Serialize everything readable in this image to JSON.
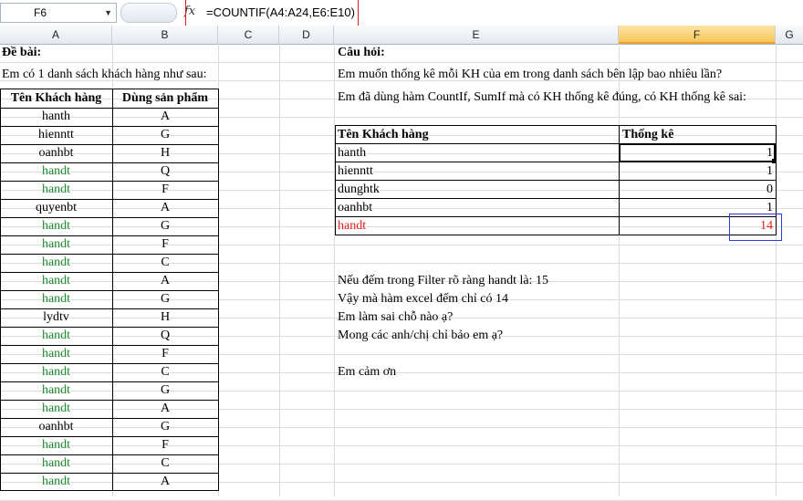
{
  "formula_bar": {
    "name_box": "F6",
    "fx_label": "fx",
    "formula": "=COUNTIF(A4:A24,E6:E10)"
  },
  "columns": [
    "A",
    "B",
    "C",
    "D",
    "E",
    "F",
    "G"
  ],
  "left": {
    "title": "Đề bài:",
    "subtitle": "Em có 1 danh sách khách hàng như sau:",
    "header_name": "Tên Khách hàng",
    "header_product": "Dùng sản phẩm",
    "rows": [
      {
        "name": "hanth",
        "product": "A"
      },
      {
        "name": "hienntt",
        "product": "G"
      },
      {
        "name": "oanhbt",
        "product": "H"
      },
      {
        "name": "handt",
        "product": "Q"
      },
      {
        "name": "handt",
        "product": "F"
      },
      {
        "name": "quyenbt",
        "product": "A"
      },
      {
        "name": "handt",
        "product": "G"
      },
      {
        "name": "handt",
        "product": "F"
      },
      {
        "name": "handt",
        "product": "C"
      },
      {
        "name": "handt",
        "product": "A"
      },
      {
        "name": "handt",
        "product": "G"
      },
      {
        "name": "lydtv",
        "product": "H"
      },
      {
        "name": "handt",
        "product": "Q"
      },
      {
        "name": "handt",
        "product": "F"
      },
      {
        "name": "handt",
        "product": "C"
      },
      {
        "name": "handt",
        "product": "G"
      },
      {
        "name": "handt",
        "product": "A"
      },
      {
        "name": "oanhbt",
        "product": "G"
      },
      {
        "name": "handt",
        "product": "F"
      },
      {
        "name": "handt",
        "product": "C"
      },
      {
        "name": "handt",
        "product": "A"
      }
    ]
  },
  "right": {
    "title": "Câu hỏi:",
    "q1": "Em muốn thống kê mỗi KH của em trong danh sách bên lập bao nhiêu lần?",
    "q2": "Em đã dùng hàm CountIf, SumIf mà có KH thống kê đúng, có KH thống kê sai:",
    "header_name": "Tên Khách hàng",
    "header_count": "Thống kê",
    "rows": [
      {
        "name": "hanth",
        "count": "1"
      },
      {
        "name": "hienntt",
        "count": "1"
      },
      {
        "name": "dunghtk",
        "count": "0"
      },
      {
        "name": "oanhbt",
        "count": "1"
      },
      {
        "name": "handt",
        "count": "14"
      }
    ],
    "notes": [
      "Nếu đếm trong Filter rõ ràng handt là: 15",
      "Vậy mà hàm excel đếm chỉ có 14",
      "Em làm sai chỗ nào ạ?",
      "Mong các anh/chị chỉ bảo em ạ?",
      "",
      "Em cảm ơn"
    ]
  },
  "colors": {
    "green": "#1e8a2e",
    "red": "#e01b1b",
    "selection": "#f6c75b"
  }
}
